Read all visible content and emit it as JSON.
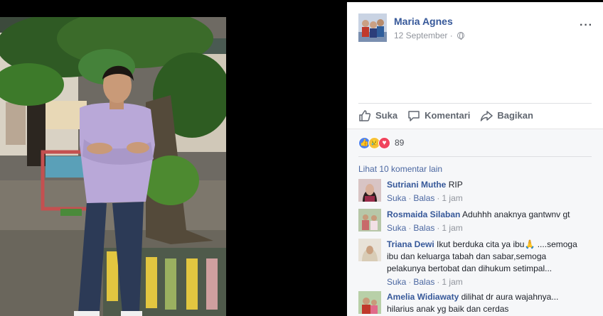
{
  "post": {
    "author": "Maria Agnes",
    "date": "12 September",
    "more_label": "···"
  },
  "actions": {
    "like": "Suka",
    "comment": "Komentari",
    "share": "Bagikan"
  },
  "reactions": {
    "count": "89",
    "types": [
      "like-icon",
      "sad-icon",
      "love-icon"
    ]
  },
  "comments_section": {
    "view_more": "Lihat 10 komentar lain",
    "like_label": "Suka",
    "reply_label": "Balas",
    "items": [
      {
        "name": "Sutriani Muthe",
        "text": "RIP",
        "time": "1 jam",
        "lines": [
          "RIP"
        ]
      },
      {
        "name": "Rosmaida Silaban",
        "text": "Aduhhh anaknya gantwnv gt",
        "time": "1 jam",
        "lines": [
          "Aduhhh anaknya gantwnv gt"
        ]
      },
      {
        "name": "Triana Dewi",
        "text": "Ikut berduka cita ya ibu🙏 ....semoga ibu dan keluarga tabah dan sabar,semoga pelakunya bertobat dan dihukum setimpal...",
        "time": "1 jam",
        "lines": [
          "Ikut berduka cita ya ibu🙏 ....semoga",
          "ibu dan keluarga tabah dan sabar,semoga",
          "pelakunya bertobat dan dihukum setimpal..."
        ]
      },
      {
        "name": "Amelia Widiawaty",
        "text": "dilihat dr aura wajahnya... hilarius anak yg baik dan cerdas",
        "time": "",
        "lines": [
          "dilihat dr aura wajahnya...",
          "hilarius anak yg baik dan cerdas"
        ]
      }
    ]
  },
  "colors": {
    "link_blue": "#365899",
    "meta_gray": "#90949c",
    "panel_bg": "#ffffff",
    "comments_bg": "#f6f7f9"
  }
}
